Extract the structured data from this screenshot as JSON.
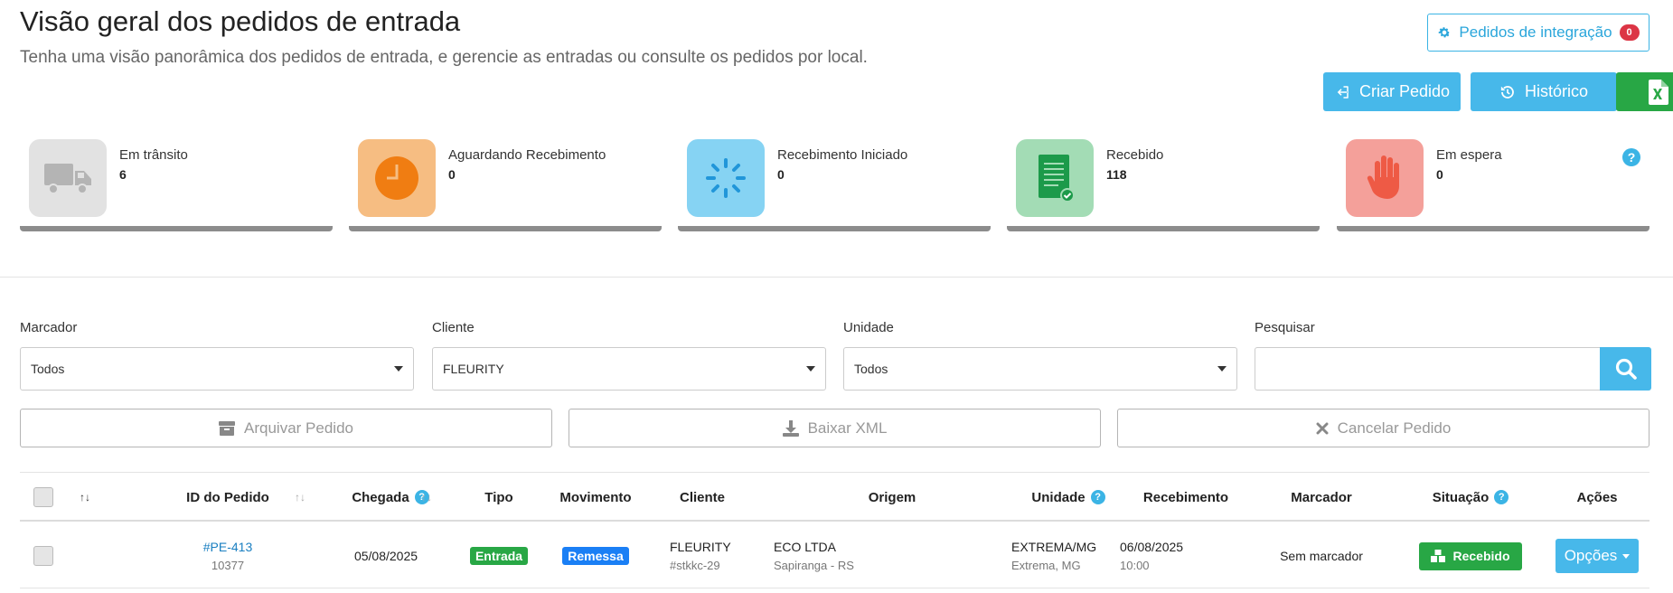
{
  "header": {
    "title": "Visão geral dos pedidos de entrada",
    "subtitle": "Tenha uma visão panorâmica dos pedidos de entrada, e gerencie as entradas ou consulte os pedidos por local.",
    "integration_label": "Pedidos de integração",
    "integration_count": "0",
    "create_label": "Criar Pedido",
    "history_label": "Histórico"
  },
  "stats": [
    {
      "label": "Em trânsito",
      "value": "6",
      "icon": "truck-icon",
      "color": "#e2e2e2"
    },
    {
      "label": "Aguardando Recebimento",
      "value": "0",
      "icon": "clock-icon",
      "color": "#f6bd82"
    },
    {
      "label": "Recebimento Iniciado",
      "value": "0",
      "icon": "spinner-icon",
      "color": "#86d3f3"
    },
    {
      "label": "Recebido",
      "value": "118",
      "icon": "document-check-icon",
      "color": "#a3dcb5"
    },
    {
      "label": "Em espera",
      "value": "0",
      "icon": "hand-icon",
      "color": "#f4a09a"
    }
  ],
  "filters": {
    "marcador": {
      "label": "Marcador",
      "value": "Todos"
    },
    "cliente": {
      "label": "Cliente",
      "value": "FLEURITY"
    },
    "unidade": {
      "label": "Unidade",
      "value": "Todos"
    },
    "pesquisar": {
      "label": "Pesquisar",
      "placeholder": ""
    }
  },
  "bulk_actions": {
    "archive": "Arquivar Pedido",
    "download_xml": "Baixar XML",
    "cancel": "Cancelar Pedido"
  },
  "table": {
    "columns": [
      "ID do Pedido",
      "Chegada",
      "Tipo",
      "Movimento",
      "Cliente",
      "Origem",
      "Unidade",
      "Recebimento",
      "Marcador",
      "Situação",
      "Ações"
    ],
    "rows": [
      {
        "id": "#PE-413",
        "id_sub": "10377",
        "chegada": "05/08/2025",
        "tipo": "Entrada",
        "movimento": "Remessa",
        "cliente": "FLEURITY",
        "cliente_sub": "#stkkc-29",
        "origem": "ECO LTDA",
        "origem_sub": "Sapiranga - RS",
        "unidade": "EXTREMA/MG",
        "unidade_sub": "Extrema, MG",
        "recebimento": "06/08/2025",
        "recebimento_sub": "10:00",
        "marcador": "Sem marcador",
        "situacao": "Recebido",
        "acoes": "Opções"
      }
    ]
  },
  "colors": {
    "accent": "#47b8ea",
    "success": "#28a745",
    "danger": "#dc3545",
    "link": "#1a7fc1"
  }
}
